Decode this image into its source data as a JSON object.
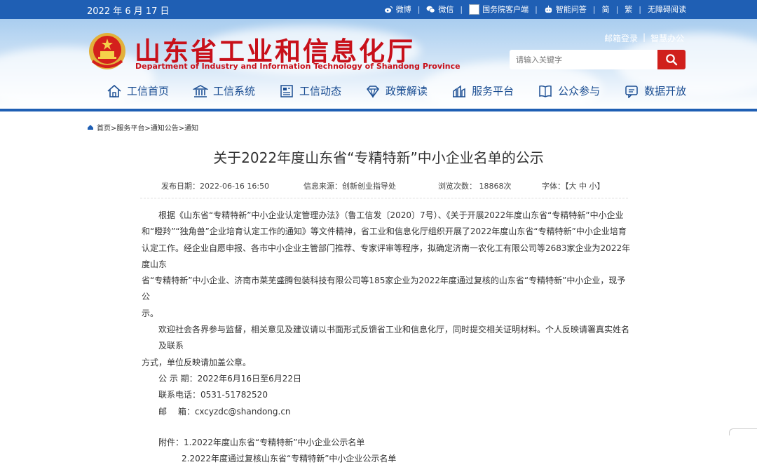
{
  "topbar": {
    "date": "2022 年 6 月 17 日",
    "links": [
      "微博",
      "微信",
      "国务院客户端",
      "智能问答",
      "简",
      "繁",
      "无障碍阅读"
    ]
  },
  "header": {
    "title_cn": "山东省工业和信息化厅",
    "title_en": "Department of Industry and Information Technology of Shandong Province",
    "login_links": [
      "邮箱登录",
      "智慧办公"
    ],
    "search_placeholder": "请输入关键字",
    "colors": {
      "topbar": "#1f5fb4",
      "title": "#c8101a",
      "search_button": "#d0201c",
      "nav_text": "#1a4d92"
    }
  },
  "nav": {
    "items": [
      {
        "label": "工信首页",
        "icon": "home-icon"
      },
      {
        "label": "工信系统",
        "icon": "building-icon"
      },
      {
        "label": "工信动态",
        "icon": "news-icon"
      },
      {
        "label": "政策解读",
        "icon": "diamond-icon"
      },
      {
        "label": "服务平台",
        "icon": "chart-icon"
      },
      {
        "label": "公众参与",
        "icon": "book-icon"
      },
      {
        "label": "数据开放",
        "icon": "chat-icon"
      }
    ]
  },
  "breadcrumb": "首页>服务平台>通知公告>通知",
  "article": {
    "title": "关于2022年度山东省“专精特新”中小企业名单的公示",
    "meta": {
      "date": "发布日期：2022-06-16 16:50",
      "source": "信息来源：创新创业指导处",
      "views": "浏览次数： 18868次",
      "font": "字体：【大 中 小】"
    },
    "para1_lines": [
      "根据《山东省“专精特新”中小企业认定管理办法》（鲁工信发〔2020〕7号）、《关于开展2022年度山东省“专精特新”中小企业",
      "和“瞪羚”“独角兽”企业培育认定工作的通知》等文件精神，省工业和信息化厅组织开展了2022年度山东省“专精特新”中小企业培育",
      "认定工作。经企业自愿申报、各市中小企业主管部门推荐、专家评审等程序，拟确定济南一农化工有限公司等2683家企业为2022年度山东",
      "省“专精特新”中小企业、济南市莱芜盛腾包装科技有限公司等185家企业为2022年度通过复核的山东省“专精特新”中小企业，现予公",
      "示。"
    ],
    "para2_lines": [
      "欢迎社会各界参与监督，相关意见及建议请以书面形式反馈省工业和信息化厅，同时提交相关证明材料。个人反映请署真实姓名及联系",
      "方式，单位反映请加盖公章。"
    ],
    "period": "公 示 期：2022年6月16日至6月22日",
    "phone": "联系电话：0531-51782520",
    "email": "邮　 箱：cxcyzdc@shandong.cn",
    "attachment1": "附件：1.2022年度山东省“专精特新”中小企业公示名单",
    "attachment2": "2.2022年度通过复核山东省“专精特新”中小企业公示名单"
  }
}
